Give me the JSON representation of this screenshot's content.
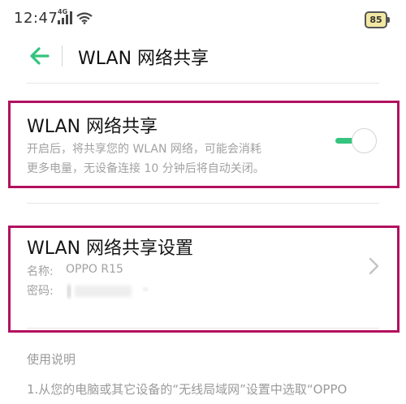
{
  "status_bar": {
    "time": "12:47",
    "network_type": "4G",
    "battery": "85"
  },
  "header": {
    "title": "WLAN 网络共享"
  },
  "hotspot_toggle": {
    "title": "WLAN 网络共享",
    "description_line1": "开启后，将共享您的 WLAN 网络，可能会消耗",
    "description_line2": "更多电量，无设备连接 10 分钟后将自动关闭。",
    "enabled": true
  },
  "hotspot_settings": {
    "title": "WLAN 网络共享设置",
    "name_label": "名称:",
    "name_value": "OPPO R15",
    "password_label": "密码:"
  },
  "usage": {
    "heading": "使用说明",
    "step1": "1.从您的电脑或其它设备的“无线局域网”设置中选取“OPPO"
  },
  "colors": {
    "accent": "#35c47d",
    "highlight": "#b2115f"
  }
}
